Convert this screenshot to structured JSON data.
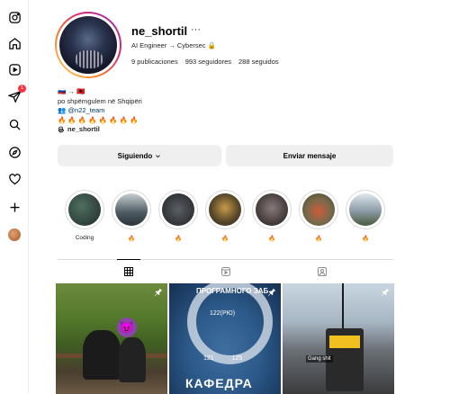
{
  "nav": {
    "items": [
      {
        "name": "instagram-logo-icon"
      },
      {
        "name": "home-icon"
      },
      {
        "name": "reels-icon"
      },
      {
        "name": "direct-messages-icon",
        "badge": "1"
      },
      {
        "name": "search-icon"
      },
      {
        "name": "explore-icon"
      },
      {
        "name": "notifications-heart-icon"
      },
      {
        "name": "create-plus-icon"
      },
      {
        "name": "profile-avatar"
      }
    ]
  },
  "profile": {
    "username": "ne_shortil",
    "more": "···",
    "title": "AI Engineer → Cybersec 🔒",
    "stats": {
      "posts": "9 publicaciones",
      "followers": "993 seguidores",
      "following": "288 seguidos"
    },
    "bio": {
      "line1": "🇷🇺 → 🇦🇱",
      "line2": "po shpërngulem në Shqipëri",
      "mention_prefix": "👥",
      "mention": "@n22_team",
      "line4": "🔥 🔥 🔥 🔥 🔥 🔥 🔥 🔥",
      "threads": "ne_shortil"
    }
  },
  "buttons": {
    "follow_label": "Siguiendo",
    "message_label": "Enviar mensaje"
  },
  "highlights": [
    {
      "label": "Coding",
      "color": "#2f3b3a"
    },
    {
      "label": "🔥",
      "color": "#4a5a62"
    },
    {
      "label": "🔥",
      "color": "#3a3f44"
    },
    {
      "label": "🔥",
      "color": "#5b4a2a"
    },
    {
      "label": "🔥",
      "color": "#4e4444"
    },
    {
      "label": "🔥",
      "color": "#7a6a4a"
    },
    {
      "label": "🔥",
      "color": "#8a9aa6"
    }
  ],
  "tabs": [
    {
      "name": "posts-grid-tab",
      "active": true
    },
    {
      "name": "reels-tab",
      "active": false
    },
    {
      "name": "tagged-tab",
      "active": false
    }
  ],
  "posts": [
    {
      "name": "post-1",
      "emoji": "😈"
    },
    {
      "name": "post-2",
      "top_text": "ПРОГРАМНОГО ЗАБ",
      "numbers_top": "122(РЮ)",
      "numbers_bottom": "121 125",
      "caption": "КАФЕДРА"
    },
    {
      "name": "post-3",
      "label": "Gang shit"
    }
  ]
}
